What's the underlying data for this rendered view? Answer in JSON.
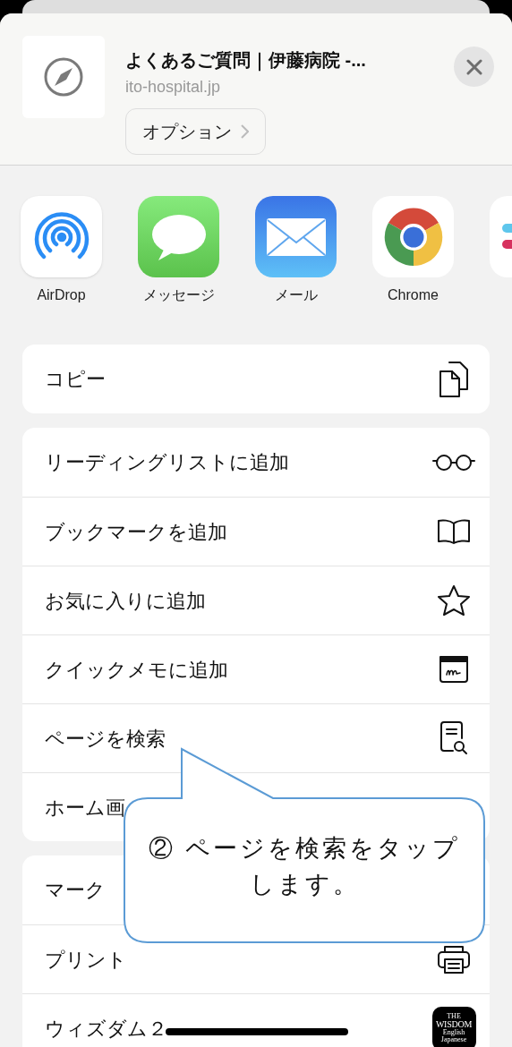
{
  "header": {
    "title": "よくあるご質問｜伊藤病院 -...",
    "url": "ito-hospital.jp",
    "options_button": "オプション"
  },
  "apps": [
    {
      "kind": "airdrop",
      "label": "AirDrop"
    },
    {
      "kind": "messages",
      "label": "メッセージ"
    },
    {
      "kind": "mail",
      "label": "メール"
    },
    {
      "kind": "chrome",
      "label": "Chrome"
    },
    {
      "kind": "slack"
    }
  ],
  "action_groups": [
    [
      {
        "label": "コピー",
        "kind": "copy"
      }
    ],
    [
      {
        "label": "リーディングリストに追加",
        "kind": "glasses"
      },
      {
        "label": "ブックマークを追加",
        "kind": "book"
      },
      {
        "label": "お気に入りに追加",
        "kind": "star"
      },
      {
        "label": "クイックメモに追加",
        "kind": "note"
      },
      {
        "label": "ページを検索",
        "kind": "search-page"
      },
      {
        "label": "ホーム画"
      }
    ],
    [
      {
        "label": "マーク"
      },
      {
        "label": "プリント",
        "kind": "print"
      },
      {
        "label": "ウィズダム２",
        "kind": "wisdom",
        "icon_text": [
          "THE",
          "WISDOM",
          "English",
          "Japanese"
        ]
      }
    ]
  ],
  "callout": {
    "text": "② ページを検索をタップします。"
  }
}
